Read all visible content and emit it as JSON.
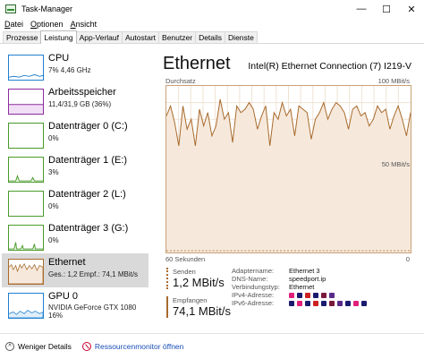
{
  "window": {
    "title": "Task-Manager",
    "minimize": "—",
    "maximize": "☐",
    "close": "✕"
  },
  "menu": [
    {
      "key": "D",
      "rest": "atei"
    },
    {
      "key": "O",
      "rest": "ptionen"
    },
    {
      "key": "A",
      "rest": "nsicht"
    }
  ],
  "tabs": [
    "Prozesse",
    "Leistung",
    "App-Verlauf",
    "Autostart",
    "Benutzer",
    "Details",
    "Dienste"
  ],
  "active_tab": "Leistung",
  "sidebar": {
    "items": [
      {
        "label": "CPU",
        "line1": "7% 4,46 GHz",
        "line2": "",
        "color": "#1f7fd0"
      },
      {
        "label": "Arbeitsspeicher",
        "line1": "11,4/31,9 GB (36%)",
        "line2": "",
        "color": "#8b2c9e"
      },
      {
        "label": "Datenträger 0 (C:)",
        "line1": "0%",
        "line2": "",
        "color": "#4a9a2a"
      },
      {
        "label": "Datenträger 1 (E:)",
        "line1": "3%",
        "line2": "",
        "color": "#4a9a2a"
      },
      {
        "label": "Datenträger 2 (L:)",
        "line1": "0%",
        "line2": "",
        "color": "#4a9a2a"
      },
      {
        "label": "Datenträger 3 (G:)",
        "line1": "0%",
        "line2": "",
        "color": "#4a9a2a"
      },
      {
        "label": "Ethernet",
        "line1": "Ges.: 1,2 Empf.: 74,1 MBit/s",
        "line2": "",
        "color": "#a86a2c"
      },
      {
        "label": "GPU 0",
        "line1": "NVIDIA GeForce GTX 1080",
        "line2": "16%",
        "color": "#1f7fd0"
      }
    ]
  },
  "main": {
    "title": "Ethernet",
    "adapter": "Intel(R) Ethernet Connection (7) I219-V",
    "graph_top_left": "Durchsatz",
    "graph_top_right": "100 MBit/s",
    "graph_mid_right": "50 MBit/s",
    "graph_bottom_left": "60 Sekunden",
    "graph_bottom_right": "0",
    "throughput_percent": [
      82,
      88,
      78,
      64,
      88,
      74,
      80,
      64,
      86,
      76,
      84,
      70,
      76,
      92,
      80,
      84,
      66,
      88,
      84,
      86,
      90,
      86,
      74,
      82,
      88,
      64,
      84,
      80,
      90,
      82,
      86,
      70,
      88,
      86,
      84,
      68,
      80,
      84,
      90,
      80,
      86,
      90,
      88,
      84,
      74,
      86,
      88,
      82,
      84,
      76,
      80,
      88,
      84,
      86,
      74,
      82,
      88,
      80,
      70,
      84
    ],
    "send_label": "Senden",
    "send_value": "1,2 MBit/s",
    "recv_label": "Empfangen",
    "recv_value": "74,1 MBit/s",
    "properties": [
      {
        "key": "Adaptername:",
        "value": "Ethernet 3"
      },
      {
        "key": "DNS-Name:",
        "value": "speedport.ip"
      },
      {
        "key": "Verbindungstyp:",
        "value": "Ethernet"
      },
      {
        "key": "IPv4-Adresse:",
        "value": ""
      },
      {
        "key": "IPv6-Adresse:",
        "value": ""
      }
    ]
  },
  "footer": {
    "fewer_details": "Weniger Details",
    "resource_monitor": "Ressourcenmonitor öffnen"
  },
  "colors": {
    "ethernet": "#a86a2c",
    "ethernet_fill": "#f6e9dc",
    "link": "#1a4fb8"
  }
}
